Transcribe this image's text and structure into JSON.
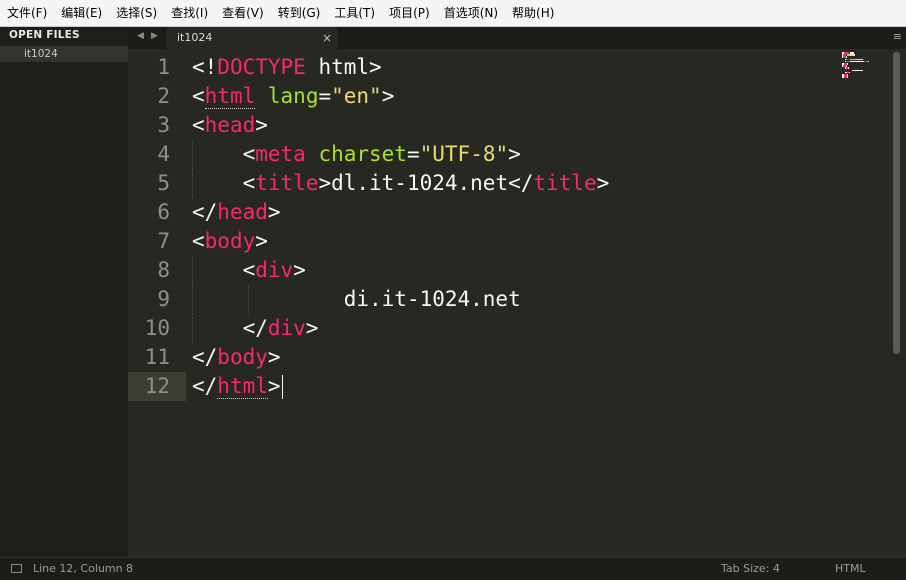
{
  "menu": [
    "文件(F)",
    "编辑(E)",
    "选择(S)",
    "查找(I)",
    "查看(V)",
    "转到(G)",
    "工具(T)",
    "项目(P)",
    "首选项(N)",
    "帮助(H)"
  ],
  "sidebar": {
    "title": "OPEN FILES",
    "files": [
      "it1024"
    ]
  },
  "tabs": [
    {
      "label": "it1024",
      "close": "×"
    }
  ],
  "tab_nav": {
    "prev": "◀",
    "next": "▶",
    "menu": "≡"
  },
  "editor": {
    "line_numbers": [
      "1",
      "2",
      "3",
      "4",
      "5",
      "6",
      "7",
      "8",
      "9",
      "10",
      "11",
      "12"
    ],
    "current_line": 12,
    "lines": [
      [
        "<!",
        "DOCTYPE",
        " html>"
      ],
      [
        "<",
        "html",
        " ",
        "lang",
        "=",
        "\"en\"",
        ">"
      ],
      [
        "<",
        "head",
        ">"
      ],
      [
        "    <",
        "meta",
        " ",
        "charset",
        "=",
        "\"UTF-8\"",
        ">"
      ],
      [
        "    <",
        "title",
        ">dl.it-1024.net</",
        "title",
        ">"
      ],
      [
        "</",
        "head",
        ">"
      ],
      [
        "<",
        "body",
        ">"
      ],
      [
        "    <",
        "div",
        ">"
      ],
      [
        "            di.it-1024.net"
      ],
      [
        "    </",
        "div",
        ">"
      ],
      [
        "</",
        "body",
        ">"
      ],
      [
        "</",
        "html",
        ">"
      ]
    ]
  },
  "colors": {
    "background": "#272822",
    "tag": "#f92672",
    "attribute": "#a6e22e",
    "string": "#e6db74",
    "text": "#f8f8f2",
    "gutter_text": "#8f908a"
  },
  "status": {
    "position": "Line 12, Column 8",
    "tab_size": "Tab Size: 4",
    "syntax": "HTML"
  }
}
